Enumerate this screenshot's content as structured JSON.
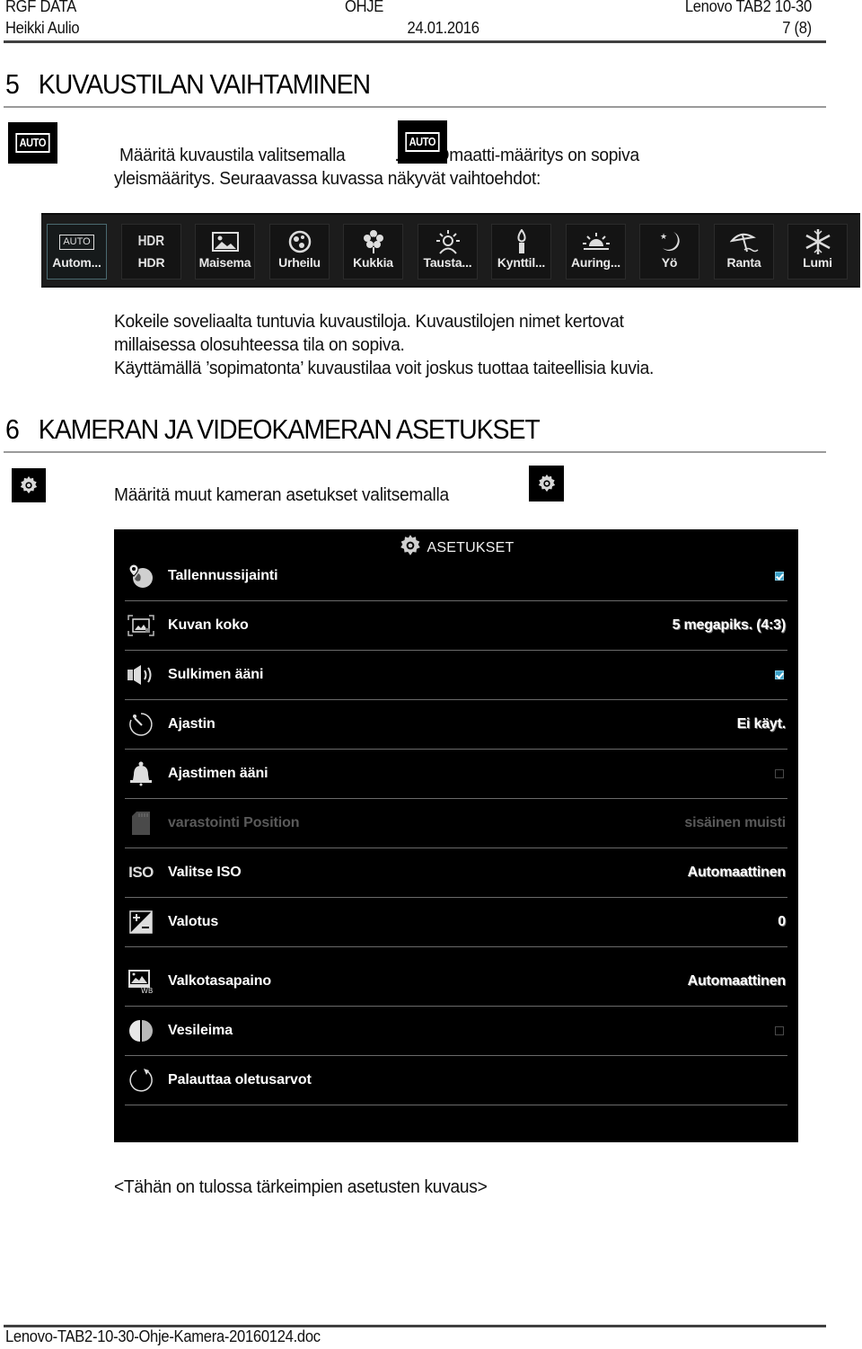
{
  "header": {
    "company": "RGF DATA",
    "doc_type": "OHJE",
    "device": "Lenovo TAB2 10-30",
    "author": "Heikki Aulio",
    "date": "24.01.2016",
    "page": "7 (8)"
  },
  "section5": {
    "number": "5",
    "title": "KUVAUSTILAN VAIHTAMINEN",
    "icon_label": "AUTO",
    "intro_line1_a": "Määritä kuvaustila valitsemalla",
    "intro_line1_b": ".  AUTOmaatti-määritys on sopiva",
    "intro_line2": "yleismääritys. Seuraavassa kuvassa näkyvät vaihtoehdot:",
    "modes": [
      {
        "icon": "auto-icon",
        "icon_text": "AUTO",
        "label": "Autom...",
        "selected": true
      },
      {
        "icon": "hdr-icon",
        "icon_text": "HDR",
        "label": "HDR"
      },
      {
        "icon": "landscape-icon",
        "label": "Maisema"
      },
      {
        "icon": "sports-ball-icon",
        "label": "Urheilu"
      },
      {
        "icon": "flower-icon",
        "label": "Kukkia"
      },
      {
        "icon": "backlight-portrait-icon",
        "label": "Tausta..."
      },
      {
        "icon": "candle-icon",
        "label": "Kynttil..."
      },
      {
        "icon": "sunset-icon",
        "label": "Auring..."
      },
      {
        "icon": "night-moon-icon",
        "label": "Yö"
      },
      {
        "icon": "beach-umbrella-icon",
        "label": "Ranta"
      },
      {
        "icon": "snowflake-icon",
        "label": "Lumi"
      }
    ],
    "para_line1": "Kokeile soveliaalta tuntuvia kuvaustiloja. Kuvaustilojen nimet kertovat",
    "para_line2": "millaisessa olosuhteessa tila on sopiva.",
    "para_line3": "Käyttämällä ’sopimatonta’ kuvaustilaa voit joskus tuottaa taiteellisia kuvia."
  },
  "section6": {
    "number": "6",
    "title": "KAMERAN JA VIDEOKAMERAN ASETUKSET",
    "intro": "Määritä muut kameran asetukset valitsemalla",
    "settings_title": "ASETUKSET",
    "settings": [
      {
        "icon": "location-globe-icon",
        "label": "Tallennussijainti",
        "type": "checkbox",
        "checked": true
      },
      {
        "icon": "image-size-icon",
        "label": "Kuvan koko",
        "type": "value",
        "value": "5 megapiks. (4:3)"
      },
      {
        "icon": "speaker-icon",
        "label": "Sulkimen ääni",
        "type": "checkbox",
        "checked": true
      },
      {
        "icon": "timer-icon",
        "label": "Ajastin",
        "type": "value",
        "value": "Ei käyt."
      },
      {
        "icon": "bell-icon",
        "label": "Ajastimen ääni",
        "type": "checkbox",
        "checked": false
      },
      {
        "icon": "sd-card-icon",
        "label": "varastointi Position",
        "type": "value",
        "value": "sisäinen muisti",
        "disabled": true
      },
      {
        "icon": "iso-icon",
        "label": "Valitse ISO",
        "type": "value",
        "value": "Automaattinen"
      },
      {
        "icon": "exposure-icon",
        "label": "Valotus",
        "type": "value",
        "value": "0"
      },
      {
        "icon": "white-balance-icon",
        "label": "Valkotasapaino",
        "type": "value",
        "value": "Automaattinen"
      },
      {
        "icon": "watermark-icon",
        "label": "Vesileima",
        "type": "checkbox",
        "checked": false
      },
      {
        "icon": "reset-icon",
        "label": "Palauttaa oletusarvot",
        "type": "none"
      }
    ],
    "placeholder_note": "<Tähän on tulossa tärkeimpien asetusten kuvaus>"
  },
  "footer": {
    "filename": "Lenovo-TAB2-10-30-Ohje-Kamera-20160124.doc"
  },
  "colors": {
    "checkbox_accent": "#3aa0c8",
    "panel_background": "#000000",
    "mode_bar_background": "#1c1c1c"
  }
}
